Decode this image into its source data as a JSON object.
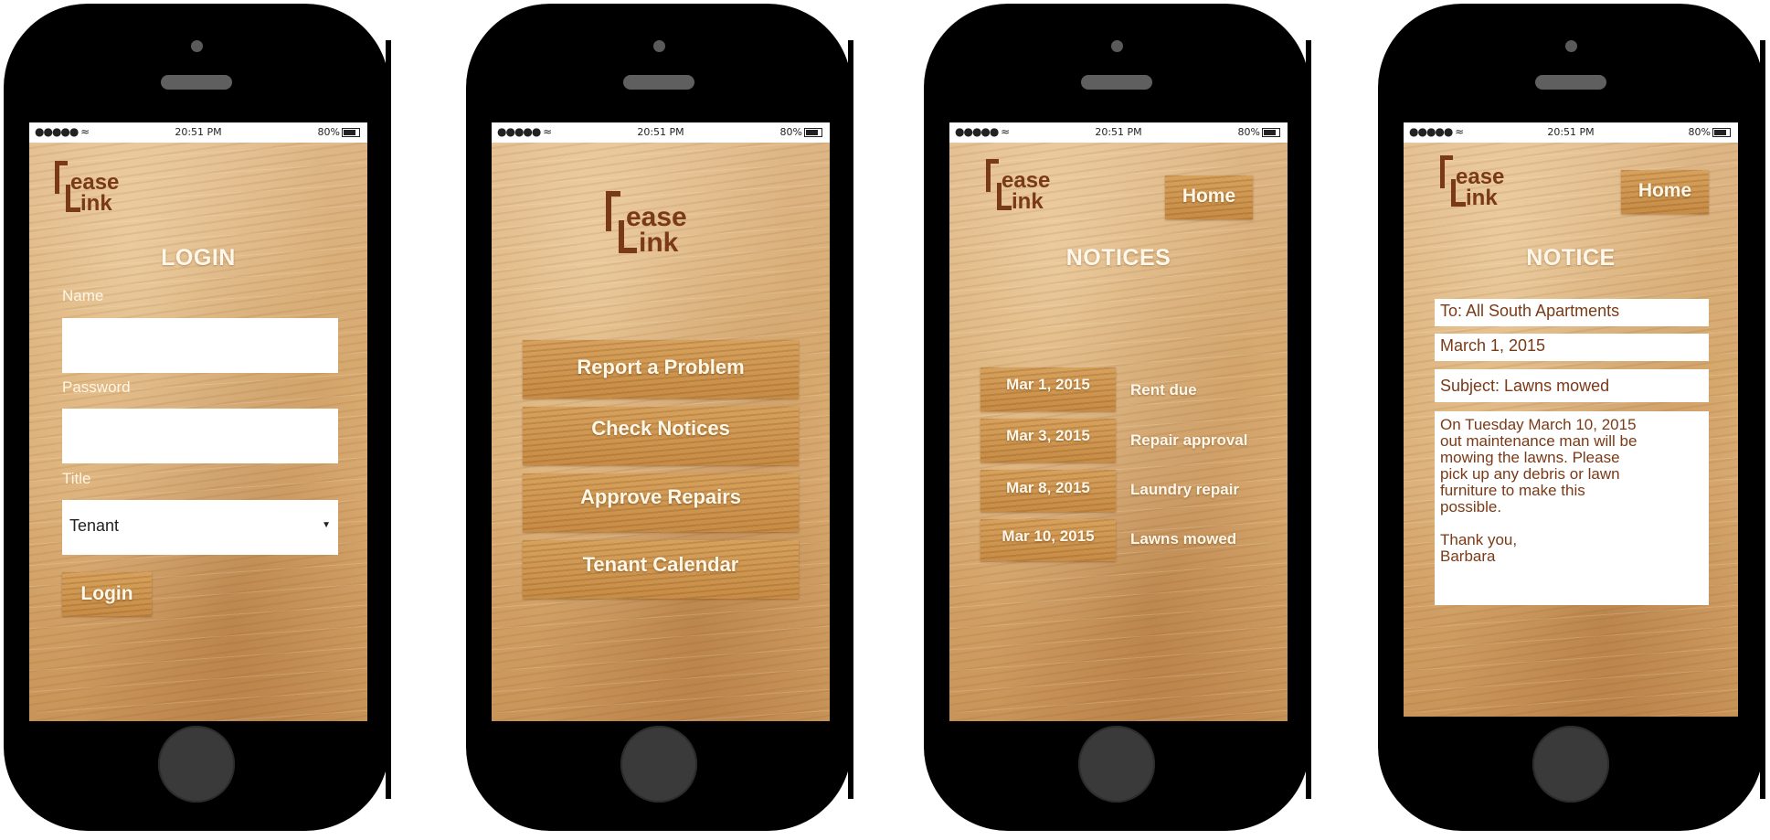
{
  "status": {
    "signal": "●●●●● ",
    "wifi": "≈",
    "time": "20:51 PM",
    "battery": "80%"
  },
  "logo": {
    "line1": "ease",
    "line2": "ink"
  },
  "login": {
    "title": "LOGIN",
    "name_label": "Name",
    "name_value": "",
    "password_label": "Password",
    "password_value": "",
    "title_label": "Title",
    "title_value": "Tenant",
    "login_button": "Login"
  },
  "menu": {
    "buttons": [
      "Report a Problem",
      "Check Notices",
      "Approve Repairs",
      "Tenant Calendar"
    ]
  },
  "notices": {
    "home_button": "Home",
    "title": "NOTICES",
    "items": [
      {
        "date": "Mar 1, 2015",
        "subject": "Rent due"
      },
      {
        "date": "Mar 3, 2015",
        "subject": "Repair approval"
      },
      {
        "date": "Mar 8, 2015",
        "subject": "Laundry repair"
      },
      {
        "date": "Mar 10, 2015",
        "subject": "Lawns mowed"
      }
    ]
  },
  "notice": {
    "home_button": "Home",
    "title": "NOTICE",
    "to": "To: All South Apartments",
    "date": "March 1, 2015",
    "subject": "Subject: Lawns mowed",
    "body": "On Tuesday March 10, 2015\nout maintenance man will be\nmowing the lawns.  Please\npick up any debris or lawn\nfurniture to make this\npossible.\n\nThank you,\nBarbara"
  },
  "colors": {
    "brand_brown": "#7a3a17",
    "wood": "#d6a96f"
  }
}
